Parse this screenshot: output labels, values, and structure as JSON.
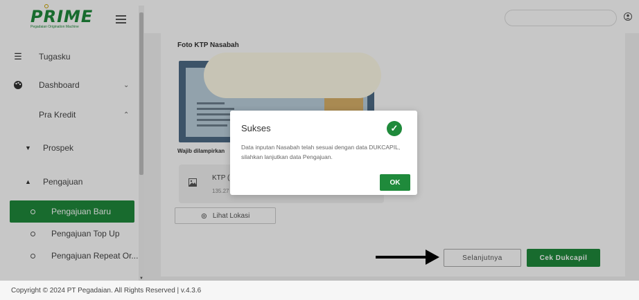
{
  "app": {
    "logo_text": "PRIME",
    "logo_tagline": "Pegadaian Origination Machine"
  },
  "sidebar": {
    "items": [
      {
        "label": "Tugasku",
        "icon": "list-icon"
      },
      {
        "label": "Dashboard",
        "icon": "palette-icon"
      },
      {
        "label": "Pra Kredit",
        "icon": ""
      }
    ],
    "sub_items": [
      {
        "label": "Prospek"
      },
      {
        "label": "Pengajuan"
      }
    ],
    "leaves": [
      {
        "label": "Pengajuan Baru",
        "active": true
      },
      {
        "label": "Pengajuan Top Up",
        "active": false
      },
      {
        "label": "Pengajuan Repeat Or...",
        "active": false
      }
    ]
  },
  "main": {
    "section_title": "Foto KTP Nasabah",
    "wajib_label": "Wajib dilampirkan",
    "file": {
      "name": "KTP (2",
      "size": "135.27"
    },
    "lokasi_label": "Lihat Lokasi",
    "next_label": "Selanjutnya",
    "cek_label": "Cek Dukcapil"
  },
  "modal": {
    "title": "Sukses",
    "body": "Data inputan Nasabah telah sesuai dengan data DUKCAPIL, silahkan lanjutkan data Pengajuan.",
    "ok_label": "OK"
  },
  "footer": {
    "text": "Copyright © 2024 PT Pegadaian. All Rights Reserved | v.4.3.6"
  },
  "colors": {
    "primary": "#1f8a3b"
  }
}
